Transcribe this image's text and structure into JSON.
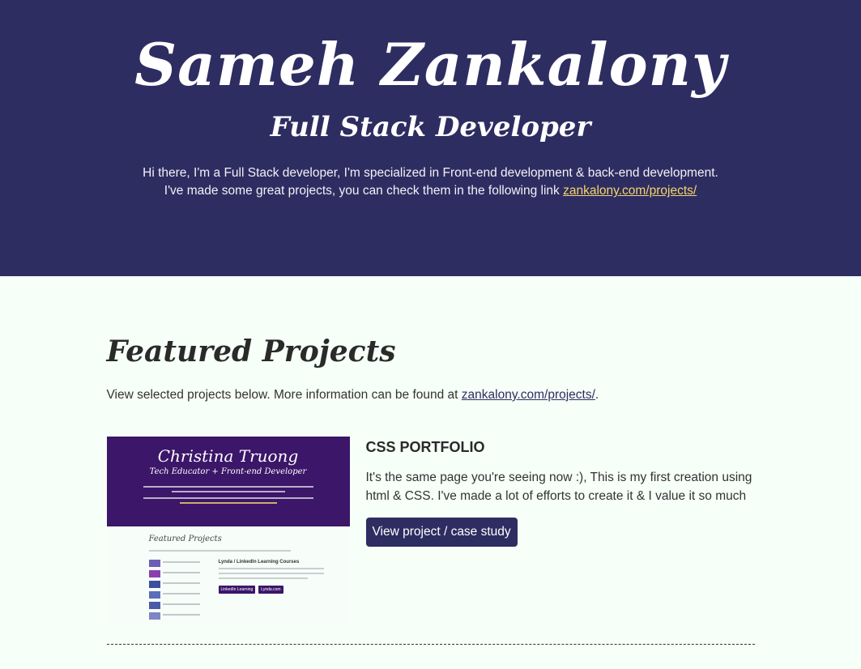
{
  "hero": {
    "name": "Sameh Zankalony",
    "role": "Full Stack Developer",
    "intro_line1": "Hi there, I'm a Full Stack developer, I'm specialized in Front-end development & back-end development.",
    "intro_line2_prefix": "I've made some great projects, you can check them in the following link ",
    "intro_link": "zankalony.com/projects/"
  },
  "featured": {
    "title": "Featured Projects",
    "desc_prefix": "View selected projects below. More information can be found at ",
    "desc_link": "zankalony.com/projects/",
    "desc_suffix": "."
  },
  "projects": [
    {
      "title": "CSS PORTFOLIO",
      "description": "It's the same page you're seeing now :), This is my first creation using html & CSS. I've made a lot of efforts to create it & I value it so much",
      "button_label": "View project / case study",
      "thumbnail": {
        "name": "Christina Truong",
        "role": "Tech Educator + Front-end Developer",
        "section_title": "Featured Projects",
        "detail_title": "Lynda / LinkedIn Learning Courses",
        "btn1": "LinkedIn Learning",
        "btn2": "Lynda.com"
      }
    }
  ],
  "colors": {
    "hero_bg": "#2e2d61",
    "page_bg": "#f6fff8",
    "link_hero": "#f5d56b",
    "button_bg": "#2e2d61",
    "thumb_bg": "#3b1669"
  }
}
